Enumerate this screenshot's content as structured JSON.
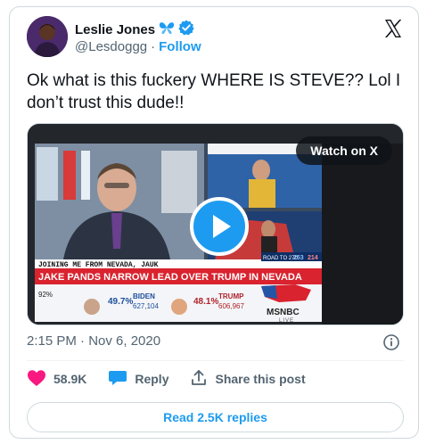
{
  "author": {
    "name": "Leslie Jones",
    "handle": "@Lesdoggg",
    "separator": "·",
    "follow_label": "Follow"
  },
  "tweet": {
    "text": "Ok what is this fuckery WHERE IS STEVE?? Lol I don’t trust this dude!!",
    "timestamp": "2:15 PM · Nov 6, 2020"
  },
  "media": {
    "watch_label": "Watch on X",
    "chyron": {
      "top_tag": "JOINING ME FROM NEVADA, JAUK",
      "headline": "JAKE  PANDS NARROW LEAD OVER TRUMP IN NEVADA",
      "biden_pct": "49.7%",
      "biden_name": "BIDEN",
      "biden_votes": "627,104",
      "trump_pct": "48.1%",
      "trump_name": "TRUMP",
      "trump_votes": "606,967",
      "reporting": "92%",
      "network": "MSNBC",
      "live": "LIVE",
      "score_road": "ROAD TO 270",
      "score_left": "253",
      "score_right": "214"
    }
  },
  "actions": {
    "likes": "58.9K",
    "reply_label": "Reply",
    "share_label": "Share this post"
  },
  "footer": {
    "read_replies_label": "Read 2.5K replies"
  },
  "colors": {
    "accent": "#1d9bf0",
    "like": "#f91880",
    "text": "#0f1419",
    "muted": "#536471"
  }
}
